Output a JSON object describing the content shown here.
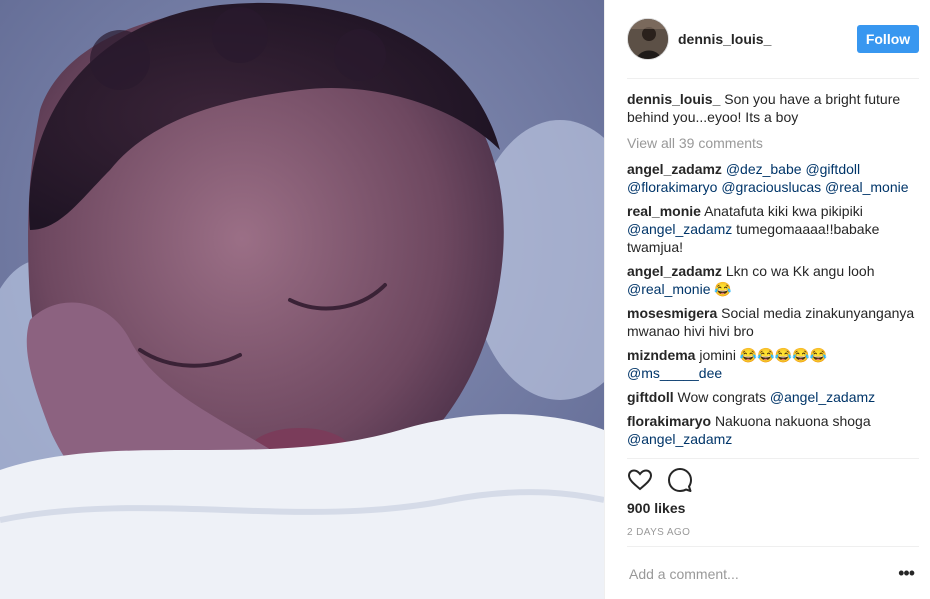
{
  "post": {
    "photo_icon": "newborn-photo",
    "author": "dennis_louis_",
    "follow_label": "Follow",
    "follow_color": "#3897f0",
    "caption": {
      "user": "dennis_louis_",
      "text": "Son you have a bright future behind you...eyoo! Its a boy"
    },
    "view_all": "View all 39 comments",
    "comments": [
      {
        "user": "angel_zadamz",
        "parts": [
          {
            "mention": "@dez_babe"
          },
          {
            "text": " "
          },
          {
            "mention": "@giftdoll"
          },
          {
            "text": " "
          },
          {
            "mention": "@florakimaryo"
          },
          {
            "text": " "
          },
          {
            "mention": "@graciouslucas"
          },
          {
            "text": " "
          },
          {
            "mention": "@real_monie"
          }
        ]
      },
      {
        "user": "real_monie",
        "parts": [
          {
            "text": "Anatafuta kiki kwa pikipiki "
          },
          {
            "mention": "@angel_zadamz"
          },
          {
            "text": " tumegomaaaa!!babake twamjua!"
          }
        ]
      },
      {
        "user": "angel_zadamz",
        "parts": [
          {
            "text": "Lkn co wa Kk angu looh "
          },
          {
            "mention": "@real_monie"
          },
          {
            "text": " 😂"
          }
        ]
      },
      {
        "user": "mosesmigera",
        "parts": [
          {
            "text": "Social media zinakunyanganya mwanao hivi hivi bro"
          }
        ]
      },
      {
        "user": "mizndema",
        "parts": [
          {
            "text": "jomini 😂😂😂😂😂 "
          },
          {
            "mention": "@ms_____dee"
          }
        ]
      },
      {
        "user": "giftdoll",
        "parts": [
          {
            "text": "Wow congrats "
          },
          {
            "mention": "@angel_zadamz"
          }
        ]
      },
      {
        "user": "florakimaryo",
        "parts": [
          {
            "text": "Nakuona nakuona shoga "
          },
          {
            "mention": "@angel_zadamz"
          }
        ]
      }
    ],
    "likes": "900 likes",
    "time": "2 DAYS AGO",
    "add_comment_placeholder": "Add a comment...",
    "more_label": "•••",
    "icons": {
      "like": "heart-icon",
      "comment": "comment-icon",
      "more": "more-options-icon"
    }
  }
}
